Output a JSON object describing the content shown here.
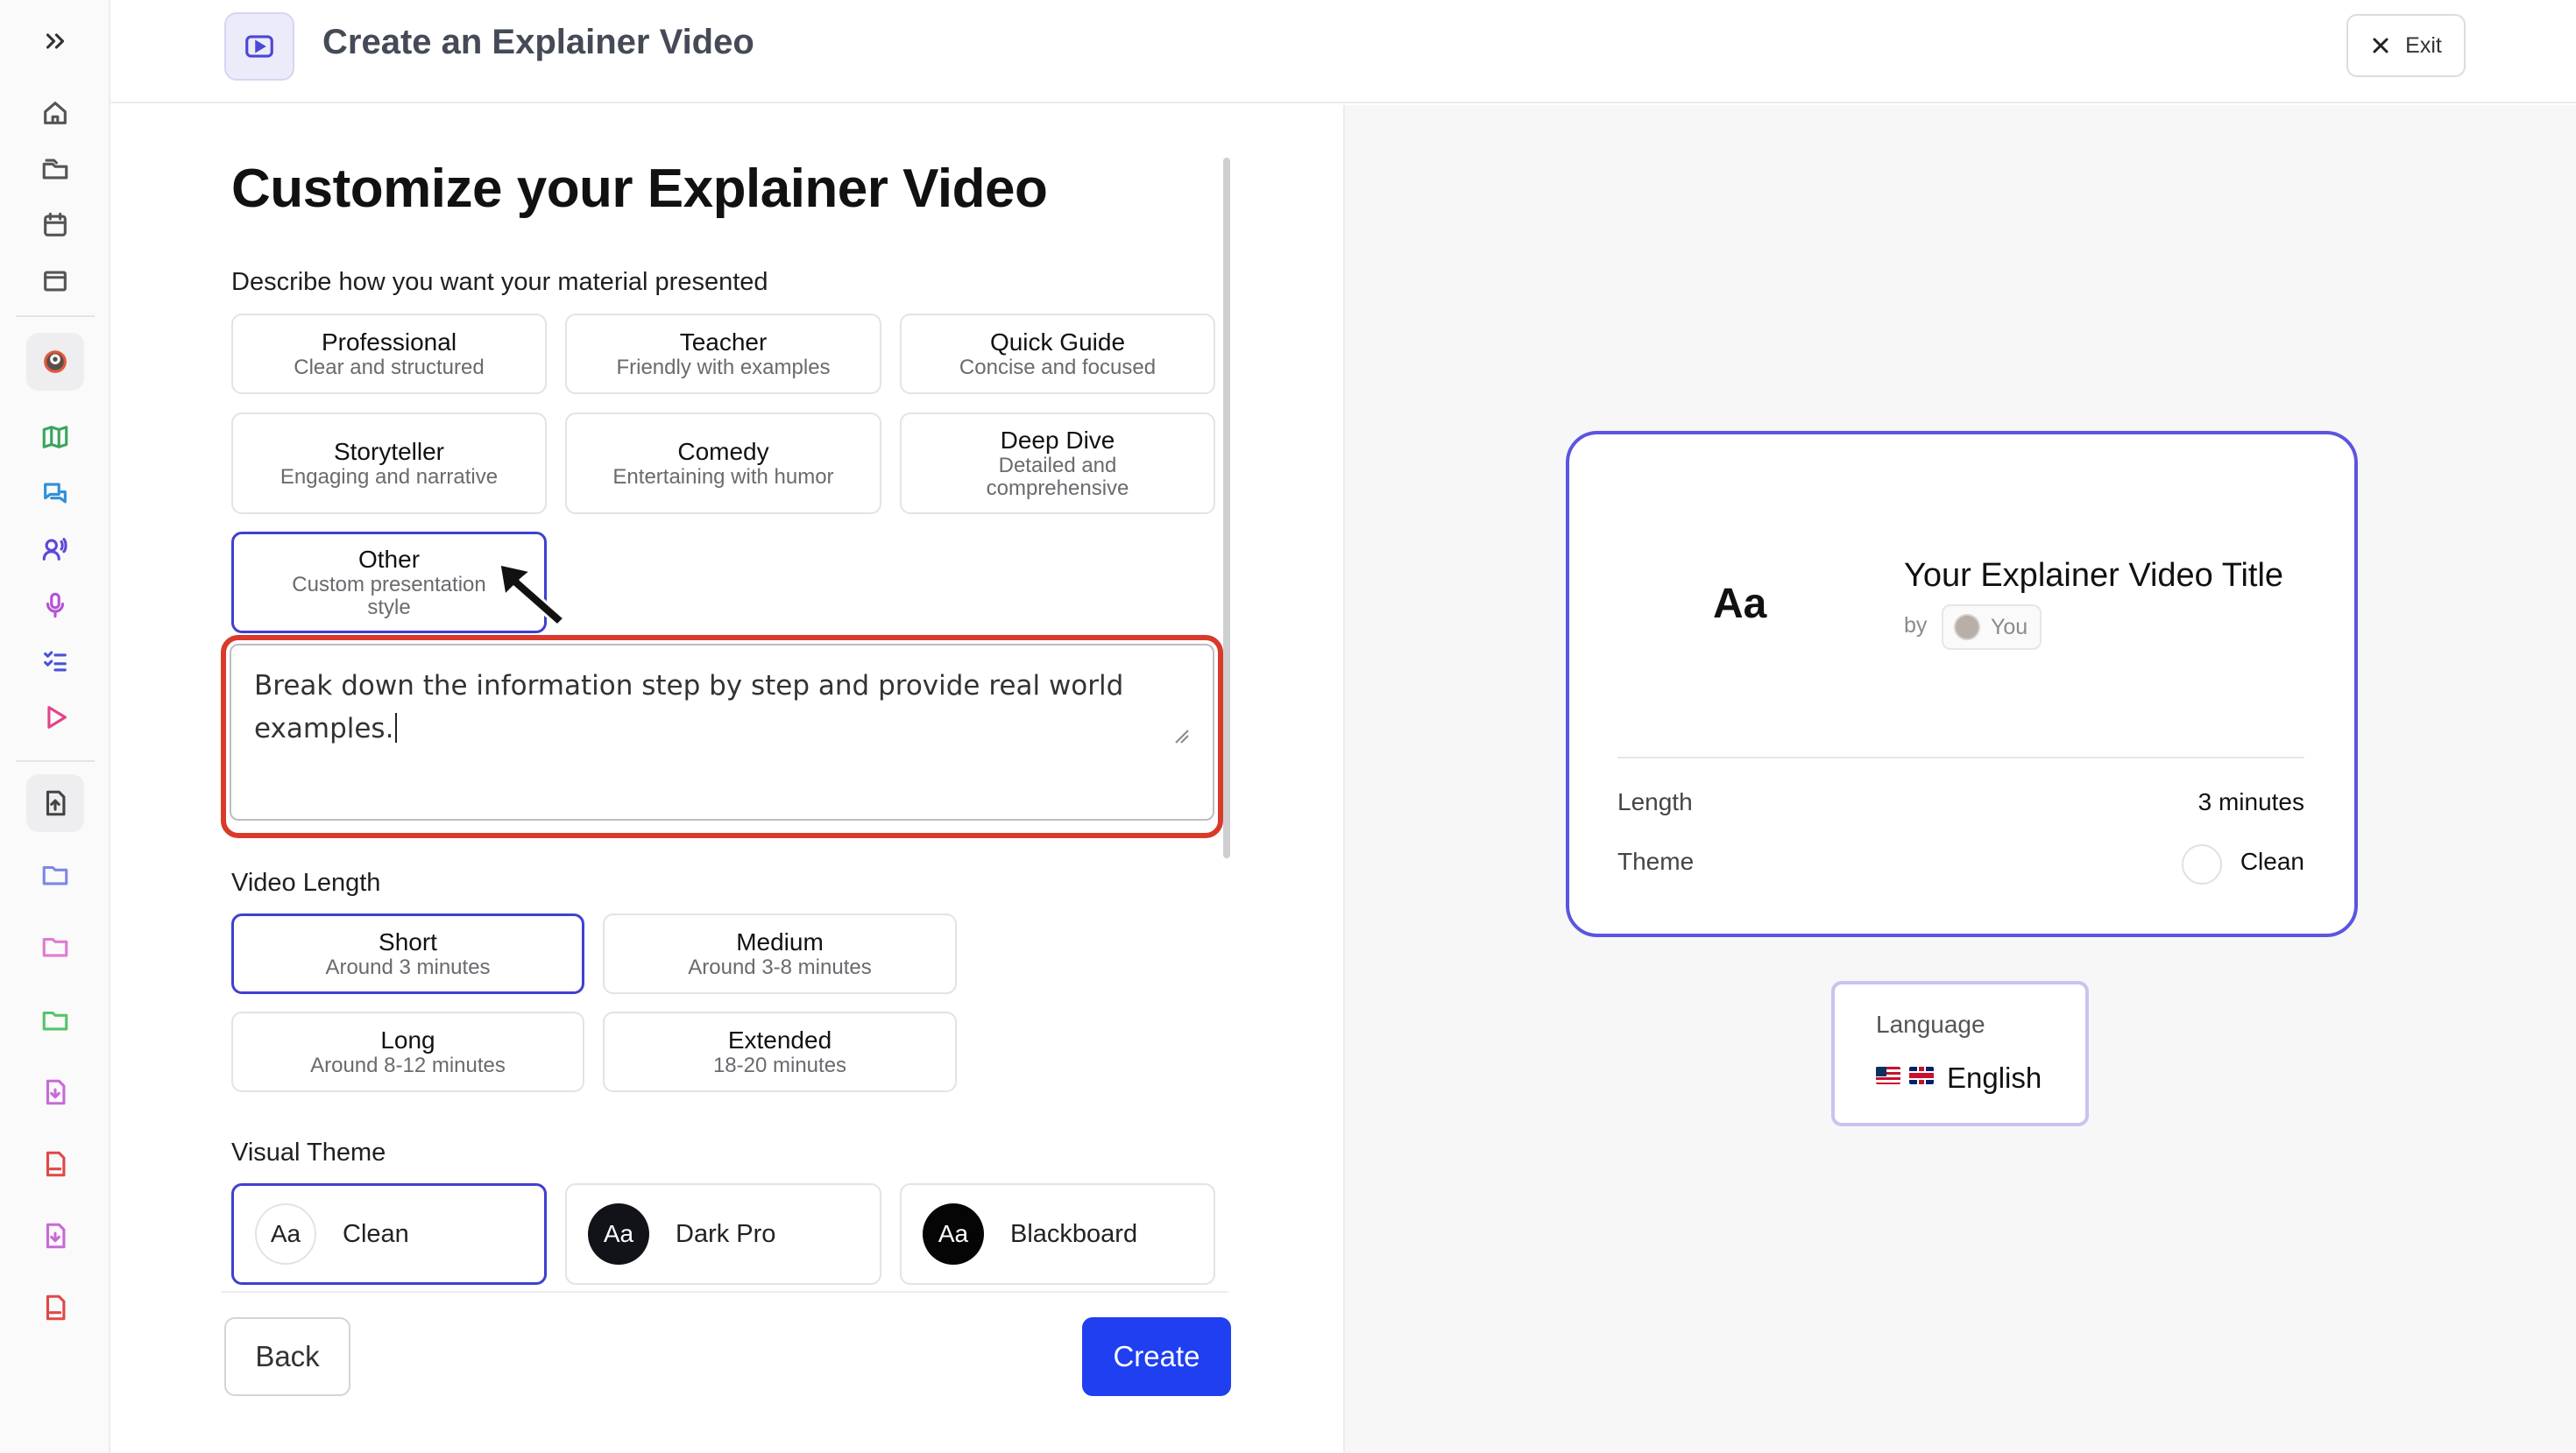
{
  "header": {
    "title": "Create an Explainer Video",
    "exit_label": "Exit"
  },
  "sidebar": {
    "icons": [
      "chevrons-right-icon",
      "home-icon",
      "folder-stack-icon",
      "calendar-icon",
      "window-icon",
      "avatar-icon",
      "map-icon",
      "chat-bubbles-icon",
      "voice-icon",
      "microphone-icon",
      "checklist-icon",
      "play-icon",
      "upload-file-icon",
      "folder-icon",
      "folder-pink-icon",
      "folder-green-icon",
      "file-download-icon",
      "pdf-icon",
      "file-download-icon",
      "pdf-icon"
    ]
  },
  "form": {
    "title": "Customize your Explainer Video",
    "style_label": "Describe how you want your material presented",
    "styles": [
      {
        "title": "Professional",
        "subtitle": "Clear and structured"
      },
      {
        "title": "Teacher",
        "subtitle": "Friendly with examples"
      },
      {
        "title": "Quick Guide",
        "subtitle": "Concise and focused"
      },
      {
        "title": "Storyteller",
        "subtitle": "Engaging and narrative"
      },
      {
        "title": "Comedy",
        "subtitle": "Entertaining with humor"
      },
      {
        "title": "Deep Dive",
        "subtitle": "Detailed and comprehensive"
      },
      {
        "title": "Other",
        "subtitle": "Custom presentation style"
      }
    ],
    "selected_style": "Other",
    "custom_style_text": "Break down the information step by step and provide real world examples.",
    "length_label": "Video Length",
    "lengths": [
      {
        "title": "Short",
        "subtitle": "Around 3 minutes"
      },
      {
        "title": "Medium",
        "subtitle": "Around 3-8 minutes"
      },
      {
        "title": "Long",
        "subtitle": "Around 8-12 minutes"
      },
      {
        "title": "Extended",
        "subtitle": "18-20 minutes"
      }
    ],
    "selected_length": "Short",
    "theme_label": "Visual Theme",
    "themes": [
      {
        "badge": "Aa",
        "label": "Clean"
      },
      {
        "badge": "Aa",
        "label": "Dark Pro"
      },
      {
        "badge": "Aa",
        "label": "Blackboard"
      }
    ],
    "selected_theme": "Clean",
    "back_label": "Back",
    "create_label": "Create"
  },
  "preview": {
    "badge": "Aa",
    "title": "Your Explainer Video Title",
    "by_label": "by",
    "author": "You",
    "length_label": "Length",
    "length_value": "3 minutes",
    "theme_label": "Theme",
    "theme_value": "Clean",
    "language_label": "Language",
    "language_value": "English"
  },
  "colors": {
    "accent": "#3f3fd0",
    "create_button": "#1f3ff0",
    "highlight_box": "#d93a2b",
    "preview_border": "#5b55e0"
  }
}
